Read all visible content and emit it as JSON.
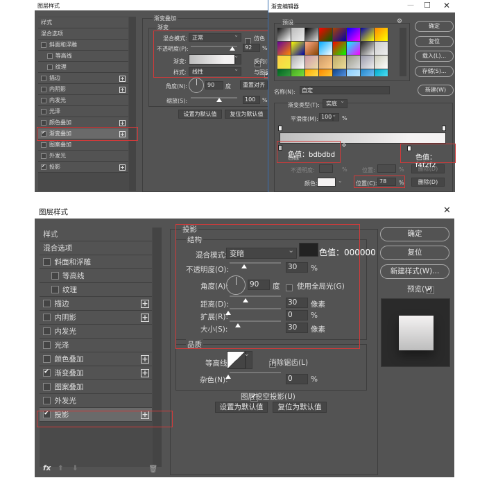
{
  "top_layer_style": {
    "title": "图层样式",
    "list": [
      {
        "label": "样式",
        "type": "header"
      },
      {
        "label": "混合选项",
        "type": "header"
      },
      {
        "label": "斜面和浮雕",
        "checked": false
      },
      {
        "label": "等高线",
        "checked": false,
        "indent": true
      },
      {
        "label": "纹理",
        "checked": false,
        "indent": true
      },
      {
        "label": "描边",
        "checked": false,
        "plus": true
      },
      {
        "label": "内阴影",
        "checked": false,
        "plus": true
      },
      {
        "label": "内发光",
        "checked": false
      },
      {
        "label": "光泽",
        "checked": false
      },
      {
        "label": "颜色叠加",
        "checked": false,
        "plus": true
      },
      {
        "label": "渐变叠加",
        "checked": true,
        "plus": true,
        "selected": true
      },
      {
        "label": "图案叠加",
        "checked": false
      },
      {
        "label": "外发光",
        "checked": false
      },
      {
        "label": "投影",
        "checked": true,
        "plus": true
      }
    ],
    "section_title": "渐变叠加",
    "group_title": "渐变",
    "blend_mode_label": "混合模式:",
    "blend_mode": "正常",
    "dither_label": "仿色",
    "opacity_label": "不透明度(P):",
    "opacity": "92",
    "opacity_unit": "%",
    "gradient_label": "渐变:",
    "reverse_label": "反向(R)",
    "style_label": "样式:",
    "style": "线性",
    "align_label": "与图层",
    "angle_label": "角度(N):",
    "angle": "90",
    "angle_unit": "度",
    "reset_align": "重置对齐",
    "scale_label": "缩放(S):",
    "scale": "100",
    "scale_unit": "%",
    "set_default": "设置为默认值",
    "reset_default": "复位为默认值"
  },
  "gradient_editor": {
    "title": "渐变编辑器",
    "presets_label": "预设",
    "presets": [
      [
        "#111",
        "#fff"
      ],
      [
        "#bbb",
        "#eee"
      ],
      [
        "#000",
        "#ddd"
      ],
      [
        "#f00",
        "#060"
      ],
      [
        "#a40",
        "#00a"
      ],
      [
        "#00f",
        "#f0f"
      ],
      [
        "#00a",
        "#ff0"
      ],
      [
        "#f80",
        "#ff0"
      ],
      [
        "#609",
        "#f80"
      ],
      [
        "#ff0",
        "#00a"
      ],
      [
        "#fa8",
        "#840"
      ],
      [
        "#0af",
        "#fff"
      ],
      [
        "#f00",
        "#0f0"
      ],
      [
        "#0ff",
        "#f0f"
      ],
      [
        "#222",
        "#eee"
      ],
      [
        "#ccc",
        "#eee"
      ],
      [
        "#fc4",
        "#ee4"
      ],
      [
        "#aaa",
        "#fff"
      ],
      [
        "#c9a",
        "#eda"
      ],
      [
        "#c96",
        "#fc8"
      ],
      [
        "#ba6",
        "#ed9"
      ],
      [
        "#998",
        "#ddd"
      ],
      [
        "#99a",
        "#eee"
      ],
      [
        "#ccb",
        "#fff"
      ],
      [
        "#062",
        "#4a4"
      ],
      [
        "#4a2",
        "#8e4"
      ],
      [
        "#fa0",
        "#fe6"
      ],
      [
        "#f80",
        "#fd4"
      ],
      [
        "#148",
        "#6af"
      ],
      [
        "#8cf",
        "#cef"
      ],
      [
        "#28c",
        "#8cf"
      ],
      [
        "#0ac",
        "#6ef"
      ]
    ],
    "buttons": {
      "ok": "确定",
      "reset": "复位",
      "load": "载入(L)...",
      "save": "存储(S)...",
      "new": "新建(W)"
    },
    "name_label": "名称(N):",
    "name_value": "自定",
    "type_label": "渐变类型(T):",
    "type_value": "实底",
    "smooth_label": "平滑度(M):",
    "smooth_value": "100",
    "smooth_unit": "%",
    "gradient_colors": [
      "#bdbdbd",
      "#f4f2f2"
    ],
    "stops_label": "色标",
    "stop_opacity_label": "不透明度:",
    "stop_opacity_unit": "%",
    "stop_position_label": "位置:",
    "stop_position_unit": "%",
    "delete_label": "删除(D)",
    "color_label": "颜色:",
    "color_swatch": "#f4f2f2",
    "color_position_label": "位置(C):",
    "color_position": "78",
    "color_position_unit": "%",
    "annotation_left": "色值：bdbdbd",
    "annotation_right": "色值：f4f2f2"
  },
  "bottom_layer_style": {
    "title": "图层样式",
    "close_icon": "close-icon",
    "list": [
      {
        "label": "样式",
        "type": "header"
      },
      {
        "label": "混合选项",
        "type": "header"
      },
      {
        "label": "斜面和浮雕",
        "checked": false
      },
      {
        "label": "等高线",
        "checked": false,
        "indent": true
      },
      {
        "label": "纹理",
        "checked": false,
        "indent": true
      },
      {
        "label": "描边",
        "checked": false,
        "plus": true
      },
      {
        "label": "内阴影",
        "checked": false,
        "plus": true
      },
      {
        "label": "内发光",
        "checked": false
      },
      {
        "label": "光泽",
        "checked": false
      },
      {
        "label": "颜色叠加",
        "checked": false,
        "plus": true
      },
      {
        "label": "渐变叠加",
        "checked": true,
        "plus": true
      },
      {
        "label": "图案叠加",
        "checked": false
      },
      {
        "label": "外发光",
        "checked": false
      },
      {
        "label": "投影",
        "checked": true,
        "plus": true,
        "selected": true
      }
    ],
    "fx_label": "fx",
    "section_title": "投影",
    "structure_title": "结构",
    "blend_mode_label": "混合模式:",
    "blend_mode": "变暗",
    "shadow_color": "#222222",
    "annotation": "色值：000000",
    "opacity_label": "不透明度(O):",
    "opacity": "30",
    "percent": "%",
    "angle_label": "角度(A):",
    "angle": "90",
    "angle_unit": "度",
    "global_light_label": "使用全局光(G)",
    "distance_label": "距离(D):",
    "distance": "30",
    "px_unit": "像素",
    "spread_label": "扩展(R):",
    "spread": "0",
    "size_label": "大小(S):",
    "size": "30",
    "quality_title": "品质",
    "contour_label": "等高线:",
    "antialias_label": "消除锯齿(L)",
    "noise_label": "杂色(N):",
    "noise": "0",
    "knockout_label": "图层挖空投影(U)",
    "set_default": "设置为默认值",
    "reset_default": "复位为默认值",
    "ok": "确定",
    "reset": "复位",
    "new_style": "新建样式(W)...",
    "preview_label": "预览(V)"
  }
}
